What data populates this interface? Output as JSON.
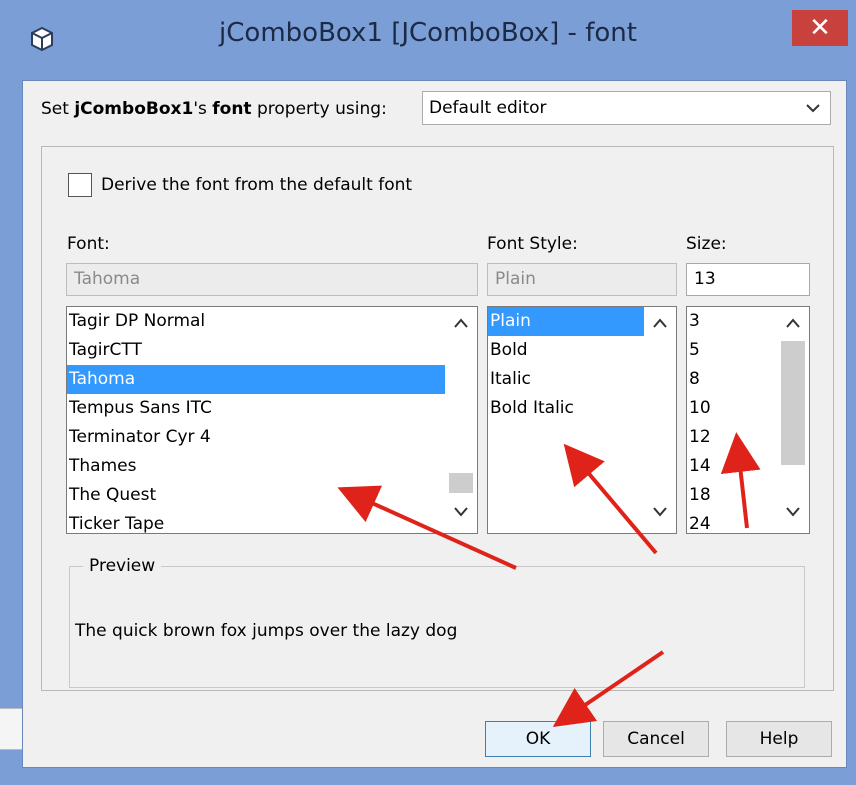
{
  "window": {
    "title": "jComboBox1 [JComboBox] - font",
    "close_label": "✕"
  },
  "property_row": {
    "prefix": "Set ",
    "component": "jComboBox1",
    "mid": "'s ",
    "property": "font",
    "suffix": " property using:",
    "editor_value": "Default editor"
  },
  "derive": {
    "label": "Derive the font from the default font",
    "checked": false
  },
  "font_column": {
    "label": "Font:",
    "value": "Tahoma",
    "items": [
      "Tagir DP Normal",
      "TagirCTT",
      "Tahoma",
      "Tempus Sans ITC",
      "Terminator Cyr 4",
      "Thames",
      "The Quest",
      "Ticker Tape"
    ],
    "selected_index": 2
  },
  "style_column": {
    "label": "Font Style:",
    "value": "Plain",
    "items": [
      "Plain",
      "Bold",
      "Italic",
      "Bold Italic"
    ],
    "selected_index": 0
  },
  "size_column": {
    "label": "Size:",
    "value": "13",
    "items": [
      "3",
      "5",
      "8",
      "10",
      "12",
      "14",
      "18",
      "24"
    ]
  },
  "preview": {
    "title": "Preview",
    "text": "The quick brown fox jumps over the lazy dog"
  },
  "buttons": {
    "ok": "OK",
    "cancel": "Cancel",
    "help": "Help"
  },
  "colors": {
    "titlebar": "#7b9ed6",
    "close": "#c8413d",
    "selection": "#3399ff",
    "annotation_arrow": "#e0231a"
  },
  "icons": {
    "window": "cube-icon",
    "close": "close-icon",
    "dropdown": "chevron-down-icon",
    "scroll_up": "chevron-up-icon",
    "scroll_down": "chevron-down-icon"
  }
}
